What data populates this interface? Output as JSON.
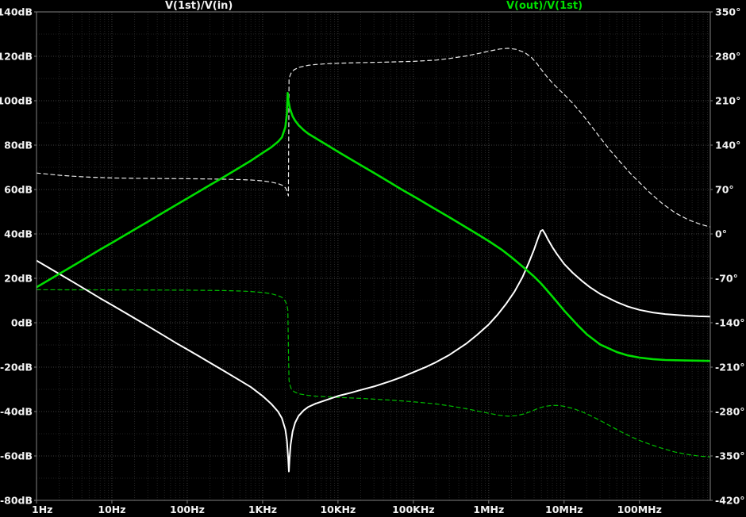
{
  "chart_data": {
    "type": "line",
    "titles": {
      "left": "V(1st)/V(in)",
      "right": "V(out)/V(1st)"
    },
    "x_axis": {
      "scale": "log",
      "unit": "Hz",
      "min": 1,
      "max": 870000000,
      "tick_values": [
        1,
        10,
        100,
        1000,
        10000,
        100000,
        1000000,
        10000000,
        100000000
      ],
      "tick_labels": [
        "1Hz",
        "10Hz",
        "100Hz",
        "1KHz",
        "10KHz",
        "100KHz",
        "1MHz",
        "10MHz",
        "100MHz"
      ]
    },
    "y_left": {
      "unit": "dB",
      "min": -80,
      "max": 140,
      "tick_step": 20,
      "minor_step": 10,
      "tick_values": [
        140,
        120,
        100,
        80,
        60,
        40,
        20,
        0,
        -20,
        -40,
        -60,
        -80
      ],
      "tick_labels": [
        "140dB",
        "120dB",
        "100dB",
        "80dB",
        "60dB",
        "40dB",
        "20dB",
        "0dB",
        "-20dB",
        "-40dB",
        "-60dB",
        "-80dB"
      ]
    },
    "y_right": {
      "unit": "deg",
      "min": -420,
      "max": 350,
      "tick_step": 70,
      "tick_values": [
        350,
        280,
        210,
        140,
        70,
        0,
        -70,
        -140,
        -210,
        -280,
        -350,
        -420
      ],
      "tick_labels": [
        "350°",
        "280°",
        "210°",
        "140°",
        "70°",
        "0°",
        "-70°",
        "-140°",
        "-210°",
        "-280°",
        "-350°",
        "-420°"
      ]
    },
    "colors": {
      "background": "#000000",
      "grid_major": "#404040",
      "grid_minor_v": "#242424",
      "grid_minor_h": "#1f1f1f",
      "border": "#7f7f7f",
      "text": "#f2f2f2",
      "trace_white": "#ffffff",
      "trace_green": "#00dd00"
    },
    "legend": [
      {
        "trace": "V(1st)/V(in)",
        "magnitude_style": "white solid",
        "phase_style": "white dashed"
      },
      {
        "trace": "V(out)/V(1st)",
        "magnitude_style": "green solid",
        "phase_style": "green dashed"
      }
    ],
    "series": [
      {
        "id": "phase-v1st-vin",
        "name": "V(1st)/V(in) phase",
        "axis": "right",
        "color": "#e8e8e8",
        "style": "dashed",
        "width": 1.2,
        "points": [
          [
            1,
            96
          ],
          [
            2,
            92.5
          ],
          [
            3,
            91
          ],
          [
            5,
            89.5
          ],
          [
            10,
            88.3
          ],
          [
            20,
            87.6
          ],
          [
            50,
            87.2
          ],
          [
            100,
            87
          ],
          [
            200,
            86.6
          ],
          [
            300,
            86.2
          ],
          [
            500,
            85.6
          ],
          [
            700,
            85
          ],
          [
            1000,
            83.6
          ],
          [
            1300,
            81.8
          ],
          [
            1600,
            79.3
          ],
          [
            1800,
            77
          ],
          [
            2000,
            73
          ],
          [
            2100,
            68.5
          ],
          [
            2160,
            63
          ],
          [
            2200,
            60
          ],
          [
            2240,
            243
          ],
          [
            2300,
            249
          ],
          [
            2400,
            254
          ],
          [
            2600,
            258.5
          ],
          [
            3000,
            262.5
          ],
          [
            4000,
            265.8
          ],
          [
            5000,
            267
          ],
          [
            7000,
            268.2
          ],
          [
            10000,
            269
          ],
          [
            20000,
            270
          ],
          [
            50000,
            271
          ],
          [
            100000,
            272
          ],
          [
            200000,
            274
          ],
          [
            300000,
            276.5
          ],
          [
            500000,
            280.5
          ],
          [
            700000,
            284
          ],
          [
            1000000,
            288
          ],
          [
            1400000,
            291.5
          ],
          [
            1800000,
            292.6
          ],
          [
            2300000,
            291
          ],
          [
            3000000,
            286
          ],
          [
            3700000,
            278
          ],
          [
            4400000,
            268
          ],
          [
            5000000,
            259
          ],
          [
            6000000,
            247
          ],
          [
            7000000,
            238
          ],
          [
            8500000,
            228
          ],
          [
            10000000,
            220
          ],
          [
            13000000,
            206
          ],
          [
            17000000,
            190
          ],
          [
            22000000,
            173
          ],
          [
            30000000,
            152
          ],
          [
            40000000,
            133
          ],
          [
            55000000,
            114
          ],
          [
            75000000,
            96
          ],
          [
            100000000,
            81
          ],
          [
            140000000,
            64
          ],
          [
            200000000,
            48
          ],
          [
            300000000,
            33
          ],
          [
            450000000,
            22
          ],
          [
            650000000,
            15
          ],
          [
            870000000,
            11
          ]
        ]
      },
      {
        "id": "phase-vout-v1st",
        "name": "V(out)/V(1st) phase",
        "axis": "right",
        "color": "#00bb00",
        "style": "dashed",
        "width": 1.2,
        "points": [
          [
            1,
            -88
          ],
          [
            10,
            -88.2
          ],
          [
            100,
            -88.6
          ],
          [
            300,
            -89.3
          ],
          [
            500,
            -90
          ],
          [
            700,
            -90.8
          ],
          [
            1000,
            -92.2
          ],
          [
            1300,
            -94.2
          ],
          [
            1600,
            -97.2
          ],
          [
            1800,
            -100
          ],
          [
            2000,
            -106
          ],
          [
            2100,
            -112
          ],
          [
            2160,
            -120
          ],
          [
            2200,
            -180
          ],
          [
            2240,
            -231
          ],
          [
            2300,
            -238
          ],
          [
            2400,
            -244
          ],
          [
            2600,
            -248.5
          ],
          [
            3000,
            -252
          ],
          [
            4000,
            -254.5
          ],
          [
            5000,
            -255.8
          ],
          [
            7000,
            -256.8
          ],
          [
            10000,
            -257.8
          ],
          [
            20000,
            -259.3
          ],
          [
            50000,
            -262
          ],
          [
            100000,
            -264.6
          ],
          [
            200000,
            -268
          ],
          [
            300000,
            -271
          ],
          [
            500000,
            -275.5
          ],
          [
            700000,
            -279
          ],
          [
            1000000,
            -282.8
          ],
          [
            1400000,
            -286
          ],
          [
            1800000,
            -287.4
          ],
          [
            2300000,
            -286.6
          ],
          [
            3000000,
            -283.5
          ],
          [
            3700000,
            -279.5
          ],
          [
            4500000,
            -275
          ],
          [
            5500000,
            -272
          ],
          [
            7000000,
            -270.3
          ],
          [
            8500000,
            -270.5
          ],
          [
            10000000,
            -271.8
          ],
          [
            13000000,
            -275
          ],
          [
            17000000,
            -280
          ],
          [
            22000000,
            -286
          ],
          [
            30000000,
            -294
          ],
          [
            40000000,
            -302
          ],
          [
            55000000,
            -311
          ],
          [
            75000000,
            -319
          ],
          [
            100000000,
            -325.5
          ],
          [
            140000000,
            -332
          ],
          [
            200000000,
            -338
          ],
          [
            300000000,
            -344
          ],
          [
            450000000,
            -348
          ],
          [
            650000000,
            -350.5
          ],
          [
            870000000,
            -351.5
          ]
        ]
      },
      {
        "id": "mag-v1st-vin",
        "name": "V(1st)/V(in) magnitude",
        "axis": "left",
        "color": "#ffffff",
        "style": "solid",
        "width": 2,
        "points": [
          [
            1,
            28
          ],
          [
            1.5,
            24.5
          ],
          [
            2,
            22
          ],
          [
            3,
            18.5
          ],
          [
            5,
            14
          ],
          [
            7,
            11
          ],
          [
            10,
            8
          ],
          [
            15,
            4.5
          ],
          [
            20,
            2
          ],
          [
            30,
            -1.5
          ],
          [
            50,
            -6
          ],
          [
            70,
            -9
          ],
          [
            100,
            -12
          ],
          [
            150,
            -15.5
          ],
          [
            200,
            -18
          ],
          [
            300,
            -21.5
          ],
          [
            500,
            -26
          ],
          [
            700,
            -29
          ],
          [
            1000,
            -33
          ],
          [
            1300,
            -36.5
          ],
          [
            1600,
            -40
          ],
          [
            1800,
            -43
          ],
          [
            2000,
            -48
          ],
          [
            2100,
            -53
          ],
          [
            2180,
            -61
          ],
          [
            2230,
            -67
          ],
          [
            2280,
            -61
          ],
          [
            2350,
            -55
          ],
          [
            2500,
            -49
          ],
          [
            2700,
            -45
          ],
          [
            3000,
            -42
          ],
          [
            3500,
            -39.5
          ],
          [
            4000,
            -38
          ],
          [
            5000,
            -36.5
          ],
          [
            7000,
            -34.8
          ],
          [
            10000,
            -33
          ],
          [
            15000,
            -31.5
          ],
          [
            20000,
            -30.3
          ],
          [
            30000,
            -28.7
          ],
          [
            50000,
            -26.3
          ],
          [
            70000,
            -24.5
          ],
          [
            100000,
            -22.3
          ],
          [
            150000,
            -19.8
          ],
          [
            200000,
            -17.8
          ],
          [
            300000,
            -14.5
          ],
          [
            500000,
            -9.5
          ],
          [
            700000,
            -5.5
          ],
          [
            1000000,
            -0.8
          ],
          [
            1300000,
            3.5
          ],
          [
            1700000,
            8.5
          ],
          [
            2200000,
            14
          ],
          [
            2800000,
            20.5
          ],
          [
            3400000,
            27
          ],
          [
            4000000,
            33
          ],
          [
            4500000,
            38
          ],
          [
            4900000,
            41.3
          ],
          [
            5200000,
            41.8
          ],
          [
            5600000,
            40
          ],
          [
            6000000,
            38
          ],
          [
            7000000,
            34
          ],
          [
            8000000,
            31
          ],
          [
            10000000,
            26.5
          ],
          [
            13000000,
            22.5
          ],
          [
            17000000,
            19
          ],
          [
            22000000,
            16
          ],
          [
            30000000,
            13
          ],
          [
            50000000,
            9.3
          ],
          [
            70000000,
            7.3
          ],
          [
            100000000,
            5.8
          ],
          [
            150000000,
            4.6
          ],
          [
            220000000,
            3.9
          ],
          [
            400000000,
            3.2
          ],
          [
            600000000,
            2.9
          ],
          [
            870000000,
            2.8
          ]
        ]
      },
      {
        "id": "mag-vout-v1st",
        "name": "V(out)/V(1st) magnitude",
        "axis": "left",
        "color": "#00dd00",
        "style": "solid",
        "width": 2.6,
        "points": [
          [
            1,
            16
          ],
          [
            2,
            22
          ],
          [
            3,
            25.5
          ],
          [
            5,
            30
          ],
          [
            7,
            33
          ],
          [
            10,
            36
          ],
          [
            20,
            42
          ],
          [
            30,
            45.5
          ],
          [
            50,
            50
          ],
          [
            100,
            56
          ],
          [
            200,
            62
          ],
          [
            300,
            65.5
          ],
          [
            500,
            70
          ],
          [
            700,
            73
          ],
          [
            1000,
            76.5
          ],
          [
            1300,
            79
          ],
          [
            1600,
            81.5
          ],
          [
            1800,
            83.5
          ],
          [
            2000,
            88
          ],
          [
            2100,
            94
          ],
          [
            2150,
            103.5
          ],
          [
            2200,
            100
          ],
          [
            2300,
            96.5
          ],
          [
            2500,
            93
          ],
          [
            2700,
            91
          ],
          [
            3000,
            89
          ],
          [
            3500,
            86.8
          ],
          [
            4000,
            85.2
          ],
          [
            5000,
            83.2
          ],
          [
            7000,
            80.2
          ],
          [
            10000,
            77
          ],
          [
            15000,
            73.5
          ],
          [
            20000,
            71
          ],
          [
            30000,
            67.5
          ],
          [
            50000,
            63
          ],
          [
            70000,
            60
          ],
          [
            100000,
            57
          ],
          [
            150000,
            53.5
          ],
          [
            200000,
            51
          ],
          [
            300000,
            47.5
          ],
          [
            500000,
            43
          ],
          [
            700000,
            40
          ],
          [
            1000000,
            36.8
          ],
          [
            1500000,
            32.8
          ],
          [
            2000000,
            29.5
          ],
          [
            3000000,
            24.5
          ],
          [
            4000000,
            20.8
          ],
          [
            5000000,
            17.5
          ],
          [
            7000000,
            11.8
          ],
          [
            10000000,
            5.5
          ],
          [
            15000000,
            -1
          ],
          [
            20000000,
            -5.2
          ],
          [
            30000000,
            -9.8
          ],
          [
            50000000,
            -13.2
          ],
          [
            70000000,
            -14.7
          ],
          [
            100000000,
            -15.7
          ],
          [
            150000000,
            -16.4
          ],
          [
            220000000,
            -16.8
          ],
          [
            400000000,
            -17
          ],
          [
            870000000,
            -17.2
          ]
        ]
      }
    ]
  }
}
